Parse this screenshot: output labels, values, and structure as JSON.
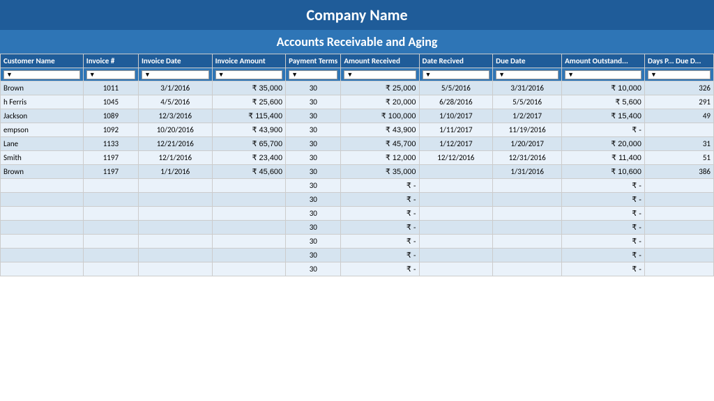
{
  "title": "Company Name",
  "subtitle": "Accounts Receivable and Aging",
  "columns": [
    {
      "key": "customer_name",
      "label": "Customer Name",
      "class": "col-customer"
    },
    {
      "key": "invoice_num",
      "label": "Invoice #",
      "class": "col-invoice"
    },
    {
      "key": "invoice_date",
      "label": "Invoice Date",
      "class": "col-invdate"
    },
    {
      "key": "invoice_amount",
      "label": "Invoice Amount",
      "class": "col-invamt"
    },
    {
      "key": "payment_terms",
      "label": "Payment Terms",
      "class": "col-payterm"
    },
    {
      "key": "amount_received",
      "label": "Amount Received",
      "class": "col-amtrec"
    },
    {
      "key": "date_received",
      "label": "Date Recived",
      "class": "col-daterec"
    },
    {
      "key": "due_date",
      "label": "Due Date",
      "class": "col-duedate"
    },
    {
      "key": "amount_outstanding",
      "label": "Amount Outstand...",
      "class": "col-amtout"
    },
    {
      "key": "days_past_due",
      "label": "Days P... Due D...",
      "class": "col-dayspdue"
    }
  ],
  "rows": [
    {
      "customer_name": "Brown",
      "invoice_num": "1011",
      "invoice_date": "3/1/2016",
      "invoice_amount": "₹  35,000",
      "payment_terms": "30",
      "amount_received": "₹  25,000",
      "date_received": "5/5/2016",
      "due_date": "3/31/2016",
      "amount_outstanding": "₹  10,000",
      "days_past_due": "326"
    },
    {
      "customer_name": "h Ferris",
      "invoice_num": "1045",
      "invoice_date": "4/5/2016",
      "invoice_amount": "₹  25,600",
      "payment_terms": "30",
      "amount_received": "₹  20,000",
      "date_received": "6/28/2016",
      "due_date": "5/5/2016",
      "amount_outstanding": "₹   5,600",
      "days_past_due": "291"
    },
    {
      "customer_name": "Jackson",
      "invoice_num": "1089",
      "invoice_date": "12/3/2016",
      "invoice_amount": "₹ 115,400",
      "payment_terms": "30",
      "amount_received": "₹ 100,000",
      "date_received": "1/10/2017",
      "due_date": "1/2/2017",
      "amount_outstanding": "₹  15,400",
      "days_past_due": "49"
    },
    {
      "customer_name": "empson",
      "invoice_num": "1092",
      "invoice_date": "10/20/2016",
      "invoice_amount": "₹  43,900",
      "payment_terms": "30",
      "amount_received": "₹  43,900",
      "date_received": "1/11/2017",
      "due_date": "11/19/2016",
      "amount_outstanding": "₹         -",
      "days_past_due": ""
    },
    {
      "customer_name": "Lane",
      "invoice_num": "1133",
      "invoice_date": "12/21/2016",
      "invoice_amount": "₹  65,700",
      "payment_terms": "30",
      "amount_received": "₹  45,700",
      "date_received": "1/12/2017",
      "due_date": "1/20/2017",
      "amount_outstanding": "₹  20,000",
      "days_past_due": "31"
    },
    {
      "customer_name": "Smith",
      "invoice_num": "1197",
      "invoice_date": "12/1/2016",
      "invoice_amount": "₹  23,400",
      "payment_terms": "30",
      "amount_received": "₹  12,000",
      "date_received": "12/12/2016",
      "due_date": "12/31/2016",
      "amount_outstanding": "₹  11,400",
      "days_past_due": "51"
    },
    {
      "customer_name": "Brown",
      "invoice_num": "1197",
      "invoice_date": "1/1/2016",
      "invoice_amount": "₹  45,600",
      "payment_terms": "30",
      "amount_received": "₹  35,000",
      "date_received": "",
      "due_date": "1/31/2016",
      "amount_outstanding": "₹  10,600",
      "days_past_due": "386"
    },
    {
      "customer_name": "",
      "invoice_num": "",
      "invoice_date": "",
      "invoice_amount": "",
      "payment_terms": "30",
      "amount_received": "₹         -",
      "date_received": "",
      "due_date": "",
      "amount_outstanding": "₹         -",
      "days_past_due": ""
    },
    {
      "customer_name": "",
      "invoice_num": "",
      "invoice_date": "",
      "invoice_amount": "",
      "payment_terms": "30",
      "amount_received": "₹         -",
      "date_received": "",
      "due_date": "",
      "amount_outstanding": "₹         -",
      "days_past_due": ""
    },
    {
      "customer_name": "",
      "invoice_num": "",
      "invoice_date": "",
      "invoice_amount": "",
      "payment_terms": "30",
      "amount_received": "₹         -",
      "date_received": "",
      "due_date": "",
      "amount_outstanding": "₹         -",
      "days_past_due": ""
    },
    {
      "customer_name": "",
      "invoice_num": "",
      "invoice_date": "",
      "invoice_amount": "",
      "payment_terms": "30",
      "amount_received": "₹         -",
      "date_received": "",
      "due_date": "",
      "amount_outstanding": "₹         -",
      "days_past_due": ""
    },
    {
      "customer_name": "",
      "invoice_num": "",
      "invoice_date": "",
      "invoice_amount": "",
      "payment_terms": "30",
      "amount_received": "₹         -",
      "date_received": "",
      "due_date": "",
      "amount_outstanding": "₹         -",
      "days_past_due": ""
    },
    {
      "customer_name": "",
      "invoice_num": "",
      "invoice_date": "",
      "invoice_amount": "",
      "payment_terms": "30",
      "amount_received": "₹         -",
      "date_received": "",
      "due_date": "",
      "amount_outstanding": "₹         -",
      "days_past_due": ""
    },
    {
      "customer_name": "",
      "invoice_num": "",
      "invoice_date": "",
      "invoice_amount": "",
      "payment_terms": "30",
      "amount_received": "₹         -",
      "date_received": "",
      "due_date": "",
      "amount_outstanding": "₹         -",
      "days_past_due": ""
    }
  ]
}
